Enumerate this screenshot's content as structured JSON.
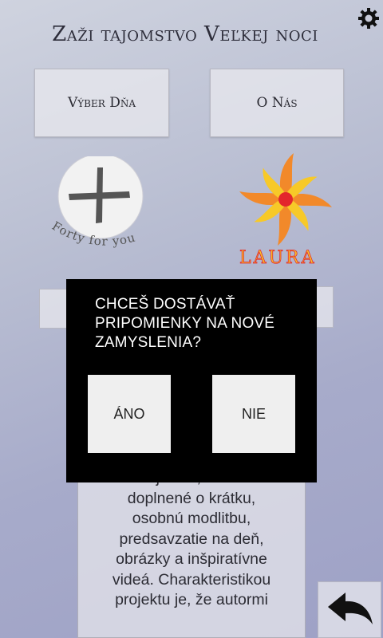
{
  "header": {
    "title": "Zaži tajomstvo Veľkej noci",
    "settings_icon": "gear-icon"
  },
  "menu": {
    "vyber_dna_label": "Výber Dňa",
    "o_nas_label": "O Nás"
  },
  "logos": {
    "forty": {
      "caption": "Forty for you",
      "icon": "cross-circle-logo"
    },
    "laura": {
      "caption": "LAURA",
      "icon": "sun-flower-logo"
    }
  },
  "description": {
    "text": "evanjeliom, ktoré sú\ndoplnené o krátku,\nosobnú modlitbu,\npredsavzatie na deň,\nobrázky a inšpiratívne\nvideá. Charakteristikou\nprojektu je, že autormi"
  },
  "navigation": {
    "back_icon": "back-arrow-icon"
  },
  "dialog": {
    "message": "CHCEŠ DOSTÁVAŤ\nPRIPOMIENKY NA NOVÉ\nZAMYSLENIA?",
    "yes_label": "ÁNO",
    "no_label": "NIE"
  },
  "colors": {
    "dialog_bg": "#000000",
    "dialog_button_bg": "#efefef",
    "laura_orange": "#f2892a",
    "laura_yellow": "#f7c928",
    "laura_red": "#e3262c"
  }
}
